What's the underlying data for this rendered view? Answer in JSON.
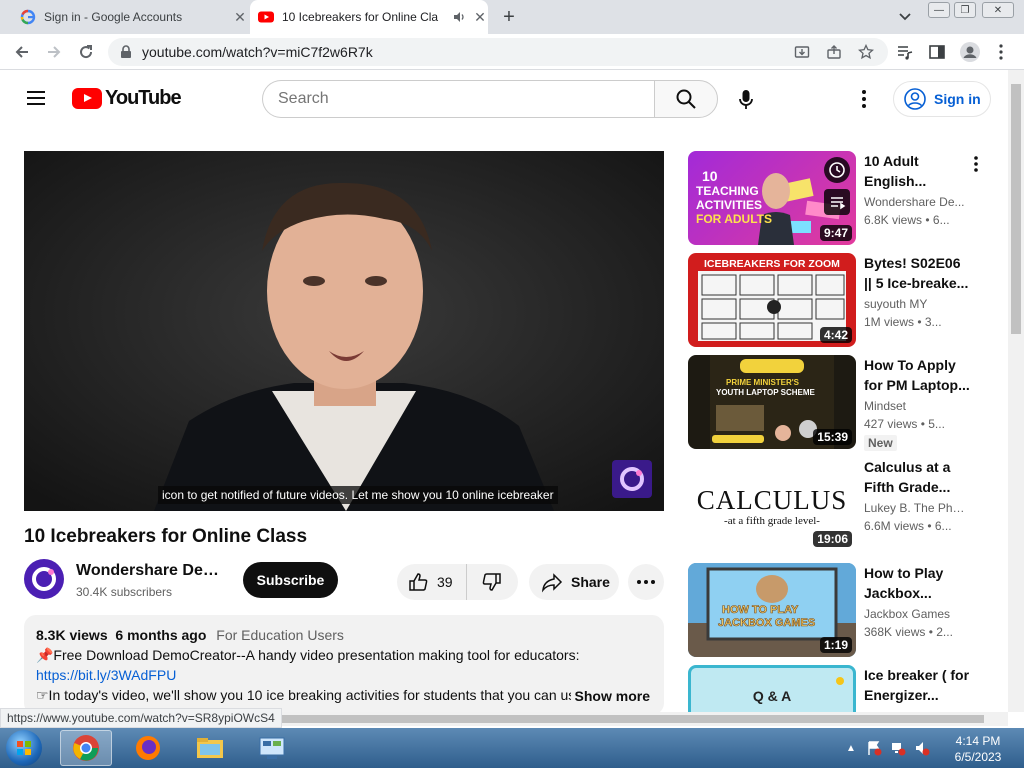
{
  "browser": {
    "tabs": [
      {
        "title": "Sign in - Google Accounts",
        "favicon": "google-g-icon"
      },
      {
        "title": "10 Icebreakers for Online Cla",
        "favicon": "youtube-icon",
        "active": true
      }
    ],
    "url": "youtube.com/watch?v=miC7f2w6R7k",
    "status_url": "https://www.youtube.com/watch?v=SR8ypiOWcS4"
  },
  "masthead": {
    "logo_text": "YouTube",
    "search_placeholder": "Search",
    "sign_in_label": "Sign in"
  },
  "player": {
    "caption": "icon to get notified of future videos. Let me show you 10 online icebreaker"
  },
  "video": {
    "title": "10 Icebreakers for Online Class",
    "channel_name": "Wondershare Dem...",
    "subscribers": "30.4K subscribers",
    "subscribe_label": "Subscribe",
    "likes": "39",
    "share_label": "Share"
  },
  "description": {
    "views": "8.3K views",
    "age": "6 months ago",
    "tagline": "For Education Users",
    "line1": "📌Free Download DemoCreator--A handy video presentation making tool for educators:",
    "link": "https://bit.ly/3WAdFPU",
    "line3": "☞In today's video, we'll show you 10 ice breaking activities for students that you can us",
    "show_more": "Show more"
  },
  "recommendations": [
    {
      "title1": "10 Adult",
      "title2": "English...",
      "channel": "Wondershare De...",
      "views": "6.8K views • 6...",
      "duration": "9:47",
      "thumb_text": "10 TEACHING ACTIVITIES FOR ADULTS"
    },
    {
      "title1": "Bytes! S02E06",
      "title2": "|| 5 Ice-breake...",
      "channel": "suyouth MY",
      "views": "1M views • 3...",
      "duration": "4:42",
      "thumb_text": "ICEBREAKERS FOR ZOOM"
    },
    {
      "title1": "How To Apply",
      "title2": "for PM Laptop...",
      "channel": "Mindset",
      "views": "427 views • 5...",
      "duration": "15:39",
      "badge": "New",
      "thumb_text": "PRIME MINISTER'S YOUTH LAPTOP SCHEME"
    },
    {
      "title1": "Calculus at a",
      "title2": "Fifth Grade...",
      "channel": "Lukey B. The Phy...",
      "views": "6.6M views • 6...",
      "duration": "19:06",
      "thumb_text": "CALCULUS",
      "thumb_sub": "-at a fifth grade level-"
    },
    {
      "title1": "How to Play",
      "title2": "Jackbox...",
      "channel": "Jackbox Games",
      "views": "368K views • 2...",
      "duration": "1:19",
      "thumb_text": "HOW TO PLAY JACKBOX GAMES"
    },
    {
      "title1": "Ice breaker ( for",
      "title2": "Energizer...",
      "thumb_text": "Q & A"
    }
  ],
  "taskbar": {
    "time": "4:14 PM",
    "date": "6/5/2023"
  },
  "colors": {
    "youtube_red": "#ff0000",
    "link_blue": "#065fd4",
    "taskbar_blue": "#2f5e8c"
  }
}
